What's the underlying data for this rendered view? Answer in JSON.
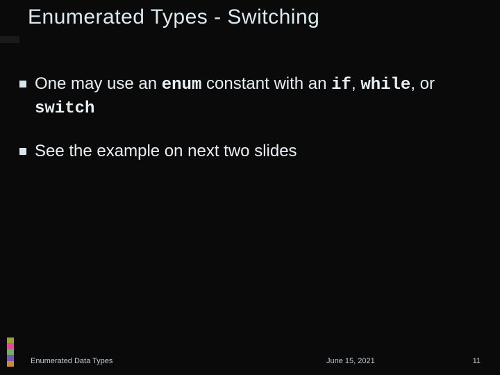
{
  "title": "Enumerated Types - Switching",
  "bullets": [
    {
      "pre": "One may use an ",
      "code1": "enum",
      "mid1": " constant with an ",
      "code2": "if",
      "mid2": ", ",
      "code3": "while",
      "mid3": ", or ",
      "code4": "switch",
      "post": ""
    },
    {
      "pre": "See the example on next two slides",
      "code1": "",
      "mid1": "",
      "code2": "",
      "mid2": "",
      "code3": "",
      "mid3": "",
      "code4": "",
      "post": ""
    }
  ],
  "footer": {
    "left": "Enumerated Data Types",
    "date": "June 15, 2021",
    "page": "11"
  }
}
